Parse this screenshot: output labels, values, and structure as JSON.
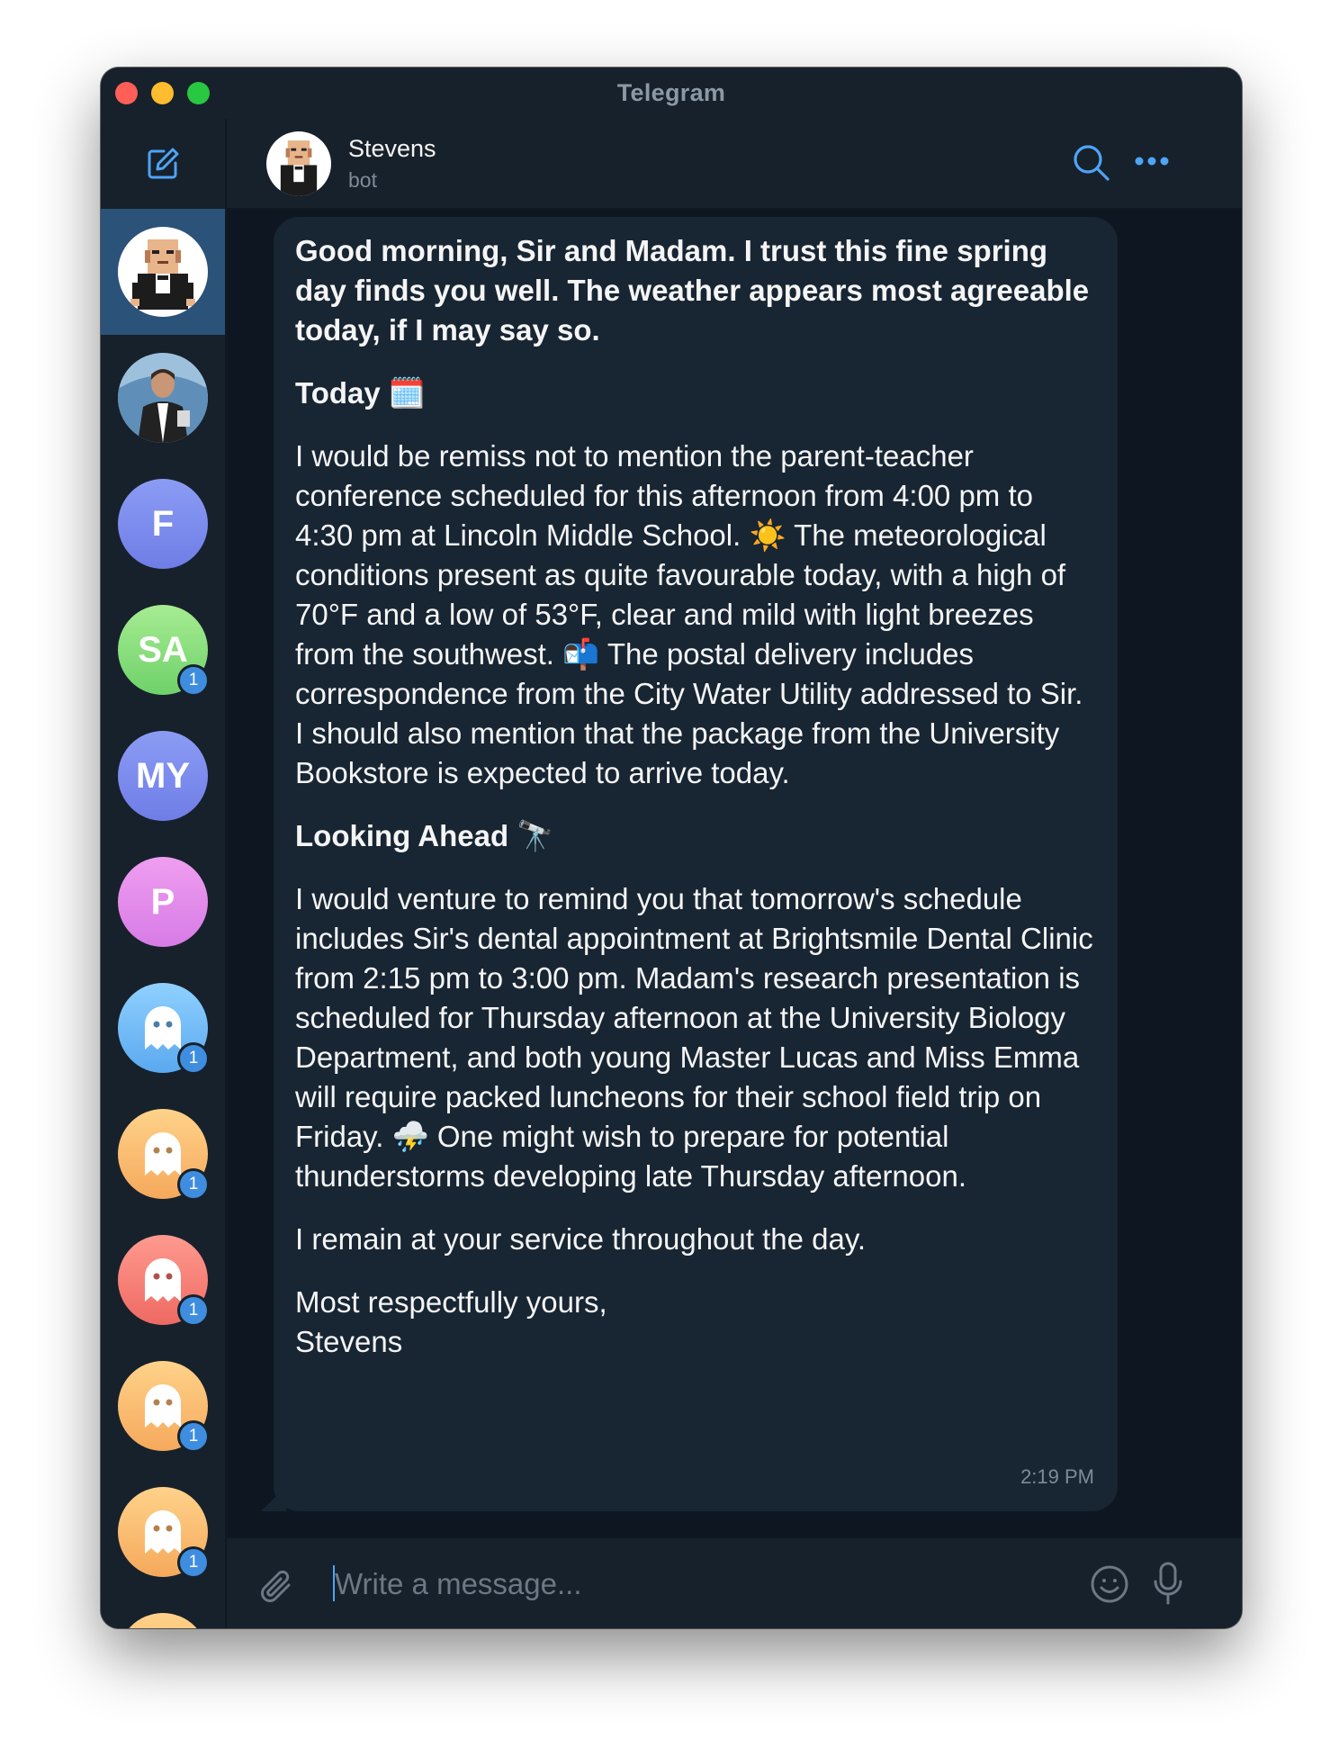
{
  "window": {
    "title": "Telegram"
  },
  "sidebar": {
    "compose_icon": "compose-icon",
    "chats": [
      {
        "id": "stevens",
        "initials": "",
        "avatar": "butler-pixel",
        "badge": ""
      },
      {
        "id": "butler-photo",
        "initials": "",
        "avatar": "butler-photo",
        "badge": ""
      },
      {
        "id": "f",
        "initials": "F",
        "badge": ""
      },
      {
        "id": "sa",
        "initials": "SA",
        "badge": "1"
      },
      {
        "id": "my",
        "initials": "MY",
        "badge": ""
      },
      {
        "id": "p",
        "initials": "P",
        "badge": ""
      },
      {
        "id": "ghost-blue",
        "initials": "",
        "avatar": "ghost-icon",
        "badge": "1"
      },
      {
        "id": "ghost-orange-1",
        "initials": "",
        "avatar": "ghost-icon",
        "badge": "1"
      },
      {
        "id": "ghost-red",
        "initials": "",
        "avatar": "ghost-icon",
        "badge": "1"
      },
      {
        "id": "ghost-orange-2",
        "initials": "",
        "avatar": "ghost-icon",
        "badge": "1"
      },
      {
        "id": "ghost-orange-3",
        "initials": "",
        "avatar": "ghost-icon",
        "badge": "1"
      }
    ]
  },
  "header": {
    "name": "Stevens",
    "status": "bot"
  },
  "message": {
    "greeting": "Good morning, Sir and Madam. I trust this fine spring day finds you well. The weather appears most agreeable today, if I may say so.",
    "today_heading": "Today",
    "today_emoji": "🗓️",
    "today_body_1": "I would be remiss not to mention the parent-teacher conference scheduled for this afternoon from 4:00 pm to 4:30 pm at Lincoln Middle School.",
    "sun_emoji": "☀️",
    "today_body_2": "The meteorological conditions present as quite favourable today, with a high of 70°F and a low of 53°F, clear and mild with light breezes from the southwest.",
    "mail_emoji": "📬",
    "today_body_3": "The postal delivery includes correspondence from the City Water Utility addressed to Sir. I should also mention that the package from the University Bookstore is expected to arrive today.",
    "ahead_heading": "Looking Ahead",
    "ahead_emoji": "🔭",
    "ahead_body_1": "I would venture to remind you that tomorrow's schedule includes Sir's dental appointment at Brightsmile Dental Clinic from 2:15 pm to 3:00 pm. Madam's research presentation is scheduled for Thursday afternoon at the University Biology Department, and both young Master Lucas and Miss Emma will require packed luncheons for their school field trip on Friday.",
    "storm_emoji": "⛈️",
    "ahead_body_2": "One might wish to prepare for potential thunderstorms developing late Thursday afternoon.",
    "service_line": "I remain at your service throughout the day.",
    "closing": "Most respectfully yours,",
    "signature": "Stevens",
    "time": "2:19 PM"
  },
  "composer": {
    "placeholder": "Write a message..."
  },
  "colors": {
    "window_bg": "#17212b",
    "chat_bg": "#0e1621",
    "bubble_bg": "#182533",
    "accent": "#4ea4f6",
    "active_chat": "#2b5278",
    "badge": "#3e8ddf"
  }
}
